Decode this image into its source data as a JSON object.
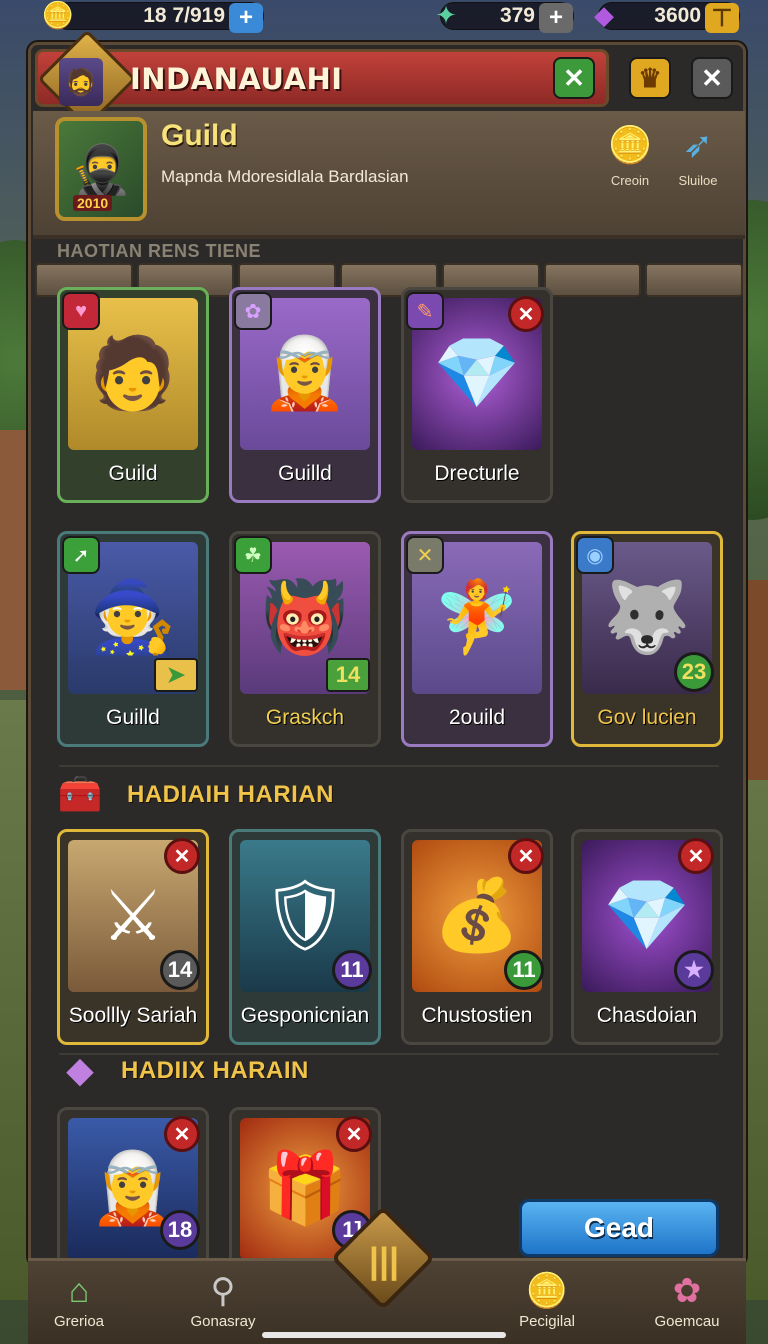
{
  "currencies": [
    {
      "icon": "gold-coin-icon",
      "glyph": "🪙",
      "value": "18 7/919",
      "btn": "+"
    },
    {
      "icon": "green-crystal-icon",
      "glyph": "✦",
      "value": "379",
      "btn": "+"
    },
    {
      "icon": "purple-gem-icon",
      "glyph": "◆",
      "value": "3600",
      "btn": "⊤"
    }
  ],
  "header": {
    "title": "INDANAUAHI",
    "btn_confirm": "✕",
    "btn_crown": "♛",
    "btn_close": "✕"
  },
  "guild": {
    "title": "Guild",
    "subtitle": "Mapnda Mdoresidlala Bardlasian",
    "level": "2010",
    "side_items": [
      {
        "label": "Creoin",
        "glyph": "🪙"
      },
      {
        "label": "Sluiloe",
        "glyph": "➶"
      }
    ]
  },
  "sections": {
    "top_label": "HAOTIAN RENS TIENE",
    "daily_label": "HADIAIH HARIAN",
    "daily2_label": "HADIIX HARAIN"
  },
  "row1": [
    {
      "name": "Guild",
      "badge": "♥",
      "art": "🧑"
    },
    {
      "name": "Guilld",
      "badge": "✿",
      "art": "🧝"
    },
    {
      "name": "Drecturle",
      "badge": "✎",
      "art": "💎"
    }
  ],
  "row2": [
    {
      "name": "Guilld",
      "badge": "➚",
      "art": "🧙",
      "level": "➤"
    },
    {
      "name": "Graskch",
      "badge": "☘",
      "art": "👹",
      "level": "14"
    },
    {
      "name": "2ouild",
      "badge": "✕",
      "art": "🧚"
    },
    {
      "name": "Gov lucien",
      "badge": "◉",
      "art": "🐺",
      "level": "23"
    }
  ],
  "row3": [
    {
      "name": "Soollly Sariah",
      "art": "⚔",
      "level": "14"
    },
    {
      "name": "Gesponicnian",
      "art": "🛡",
      "level": "11"
    },
    {
      "name": "Chustostien",
      "art": "💰",
      "level": "11"
    },
    {
      "name": "Chasdoian",
      "art": "💎",
      "level": "★"
    }
  ],
  "row4": [
    {
      "name": "",
      "art": "🧝",
      "level": "18"
    },
    {
      "name": "",
      "art": "🎁",
      "level": "1]"
    }
  ],
  "action_button": "Gead",
  "nav": [
    {
      "label": "Grerioa",
      "glyph": "⌂"
    },
    {
      "label": "Gonasray",
      "glyph": "⚲"
    },
    {
      "label": "Pecigilal",
      "glyph": "🪙"
    },
    {
      "label": "Goemcau",
      "glyph": "✿"
    }
  ],
  "nav_center": "|||",
  "colors": {
    "accent_gold": "#f0c44a",
    "header_red": "#c2413a",
    "button_blue": "#1f74c8"
  }
}
